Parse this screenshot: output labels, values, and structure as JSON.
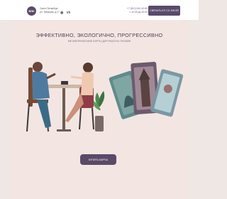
{
  "header": {
    "logo_text": "ВЛК",
    "address_line1": "Санкт-Петербург",
    "address_line2": "ул. Тверская, д.17",
    "social_icons": [
      "odnoklassniki-icon",
      "vk-icon"
    ],
    "phone1": "+7 (812) 942-42-80",
    "phone2": "с 10:00 до 20:00",
    "call_button_label": "СВЯЗАТЬСЯ СО МНОЙ"
  },
  "hero": {
    "headline": "ЭФФЕКТИВНО, ЭКОЛОГИЧНО, ПРОГРЕССИВНО",
    "subline": "МЕТАФОРИЧЕСКИЕ КАРТЫ ДЛЯ РАБОТЫ ОНЛАЙН",
    "cta_label": "КУПИТЬ КАРТЫ"
  },
  "colors": {
    "accent": "#5a4a6a",
    "background": "#efe7e3",
    "hero_bg": "#f3e6e2"
  }
}
